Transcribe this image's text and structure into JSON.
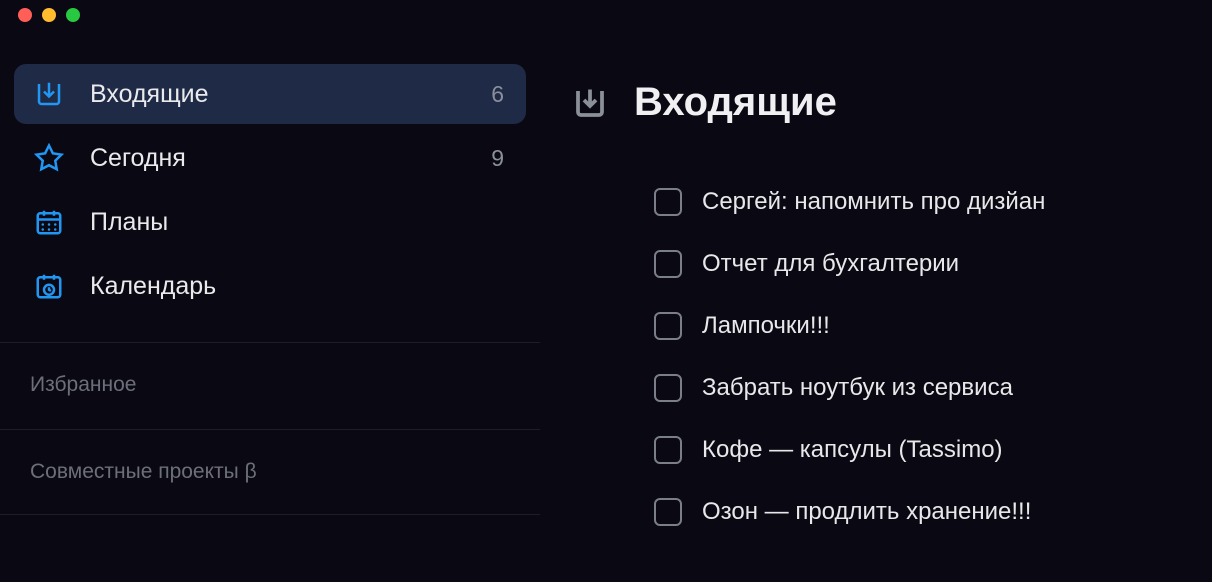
{
  "sidebar": {
    "nav": [
      {
        "icon": "inbox",
        "label": "Входящие",
        "count": "6",
        "selected": true
      },
      {
        "icon": "star",
        "label": "Сегодня",
        "count": "9",
        "selected": false
      },
      {
        "icon": "calendar-grid",
        "label": "Планы",
        "count": "",
        "selected": false
      },
      {
        "icon": "calendar-clock",
        "label": "Календарь",
        "count": "",
        "selected": false
      }
    ],
    "sections": [
      {
        "label": "Избранное"
      },
      {
        "label": "Совместные проекты β"
      }
    ]
  },
  "main": {
    "title": "Входящие",
    "tasks": [
      {
        "label": "Сергей: напомнить про дизйан",
        "done": false
      },
      {
        "label": "Отчет для бухгалтерии",
        "done": false
      },
      {
        "label": "Лампочки!!!",
        "done": false
      },
      {
        "label": "Забрать ноутбук из сервиса",
        "done": false
      },
      {
        "label": "Кофе — капсулы (Tassimo)",
        "done": false
      },
      {
        "label": "Озон — продлить хранение!!!",
        "done": false
      }
    ]
  }
}
